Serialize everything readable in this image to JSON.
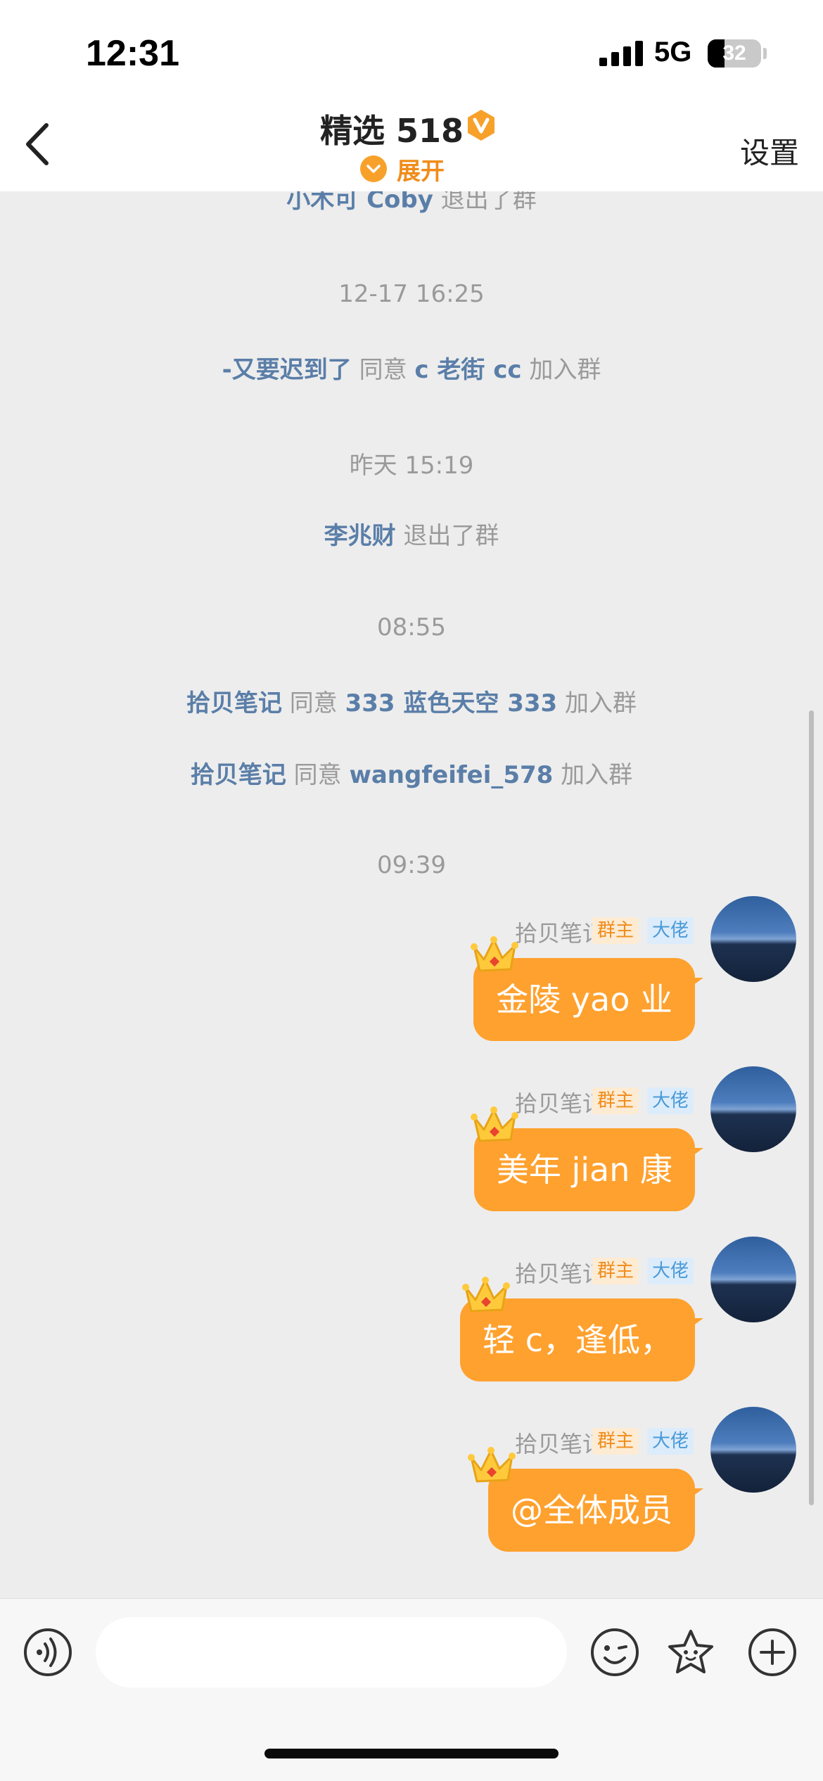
{
  "status_bar": {
    "time": "12:31",
    "network": "5G",
    "battery": "32",
    "battery_level": 0.32
  },
  "header": {
    "title": "精选 518",
    "expand_label": "展开",
    "settings_label": "设置",
    "accent": "#f7a12b"
  },
  "system_events": [
    {
      "user": "小木可 Coby",
      "action": "退出了群"
    },
    {
      "user": "-又要迟到了",
      "action_mid": "同意",
      "target": "c 老街 cc",
      "action": "加入群"
    },
    {
      "user": "李兆财",
      "action": "退出了群"
    },
    {
      "user": "拾贝笔记",
      "action_mid": "同意",
      "target": "333 蓝色天空 333",
      "action": "加入群"
    },
    {
      "user": "拾贝笔记",
      "action_mid": "同意",
      "target": "wangfeifei_578",
      "action": "加入群"
    }
  ],
  "timestamps": [
    "12-17 16:25",
    "昨天 15:19",
    "08:55",
    "09:39"
  ],
  "messages": [
    {
      "sender": "拾贝笔记",
      "tag_owner": "群主",
      "tag_level": "大佬",
      "text": "金陵 yao 业"
    },
    {
      "sender": "拾贝笔记",
      "tag_owner": "群主",
      "tag_level": "大佬",
      "text": "美年 jian 康"
    },
    {
      "sender": "拾贝笔记",
      "tag_owner": "群主",
      "tag_level": "大佬",
      "text": "轻 c，逢低，"
    },
    {
      "sender": "拾贝笔记",
      "tag_owner": "群主",
      "tag_level": "大佬",
      "text": "@全体成员"
    }
  ],
  "input": {
    "placeholder": ""
  },
  "colors": {
    "bubble": "#ffa12e",
    "link_user": "#5a7ea8",
    "owner_tag": "#f08c1a",
    "level_tag": "#4a9ad8"
  }
}
